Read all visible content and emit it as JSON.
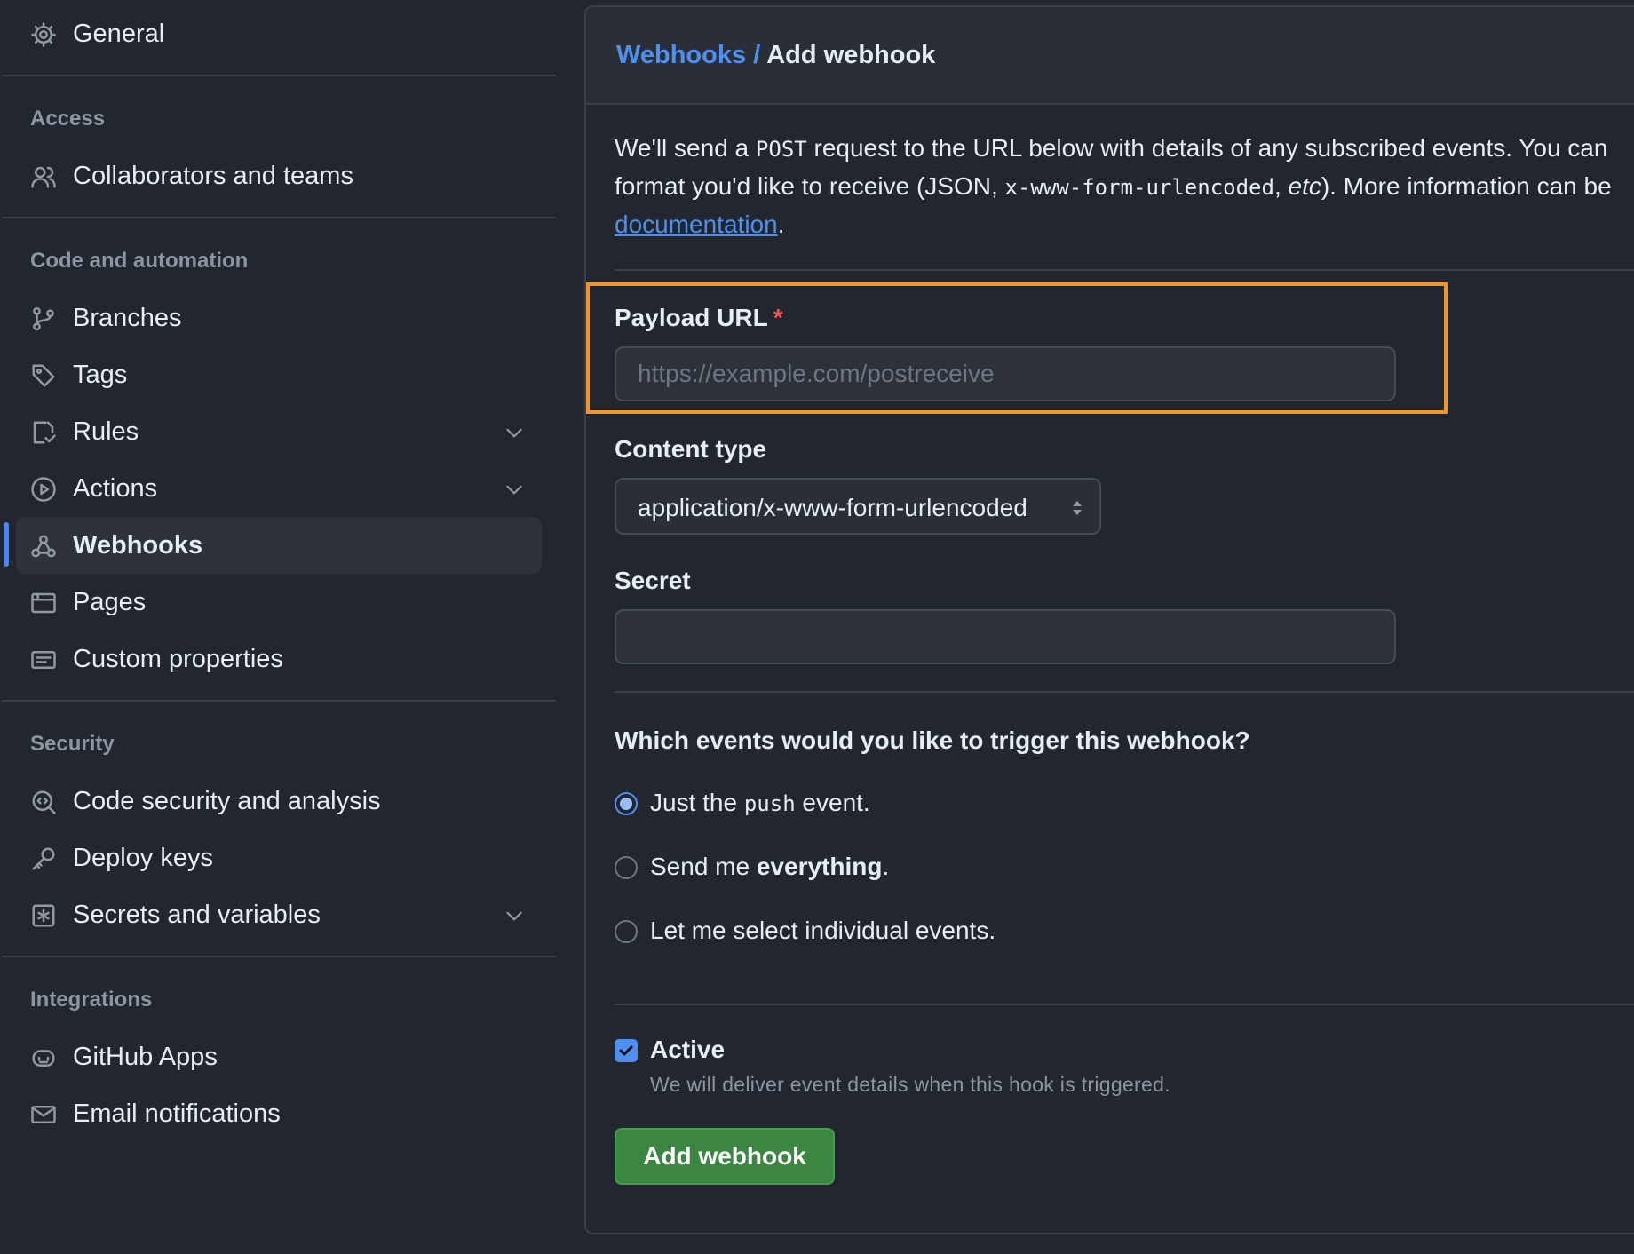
{
  "sidebar": {
    "general": "General",
    "sections": {
      "access": "Access",
      "code_automation": "Code and automation",
      "security": "Security",
      "integrations": "Integrations"
    },
    "items": {
      "collaborators": "Collaborators and teams",
      "branches": "Branches",
      "tags": "Tags",
      "rules": "Rules",
      "actions": "Actions",
      "webhooks": "Webhooks",
      "pages": "Pages",
      "custom_properties": "Custom properties",
      "code_security": "Code security and analysis",
      "deploy_keys": "Deploy keys",
      "secrets": "Secrets and variables",
      "github_apps": "GitHub Apps",
      "email_notifications": "Email notifications"
    },
    "active_item": "Webhooks"
  },
  "breadcrumb": {
    "parent": "Webhooks",
    "separator": "/",
    "current": "Add webhook"
  },
  "intro": {
    "part1": "We'll send a ",
    "code1": "POST",
    "part2": " request to the URL below with details of any subscribed events. You can",
    "part3": "format you'd like to receive (JSON, ",
    "code2": "x-www-form-urlencoded",
    "part4": ", ",
    "etc": "etc",
    "part5": "). More information can be",
    "link": "documentation",
    "end": "."
  },
  "form": {
    "payload_label": "Payload URL",
    "required_mark": "*",
    "payload_placeholder": "https://example.com/postreceive",
    "payload_value": "",
    "content_type_label": "Content type",
    "content_type_value": "application/x-www-form-urlencoded",
    "secret_label": "Secret",
    "secret_value": "",
    "events_question": "Which events would you like to trigger this webhook?",
    "radio_push_a": "Just the ",
    "radio_push_code": "push",
    "radio_push_b": " event.",
    "radio_everything_a": "Send me ",
    "radio_everything_b": "everything",
    "radio_everything_c": ".",
    "radio_individual": "Let me select individual events.",
    "selected_event": "push",
    "active_label": "Active",
    "active_checked": true,
    "active_desc": "We will deliver event details when this hook is triggered.",
    "submit": "Add webhook"
  },
  "colors": {
    "background": "#22262e",
    "accent": "#4f8fed",
    "highlight": "#f0952e",
    "button": "#3b8640"
  }
}
